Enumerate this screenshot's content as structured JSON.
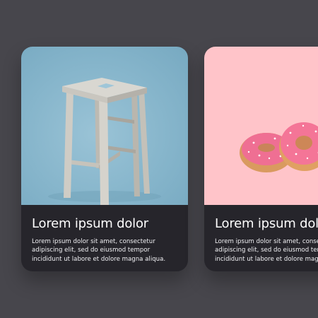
{
  "cards": [
    {
      "title": "Lorem ipsum dolor",
      "description_lines": [
        "Lorem ipsum dolor sit amet, consectetur",
        "adipiscing elit, sed do eiusmod tempor",
        "incididunt ut labore et dolore magna aliqua."
      ],
      "image": "wooden-stool",
      "image_background": "#86b5cb"
    },
    {
      "title": "Lorem ipsum dolor",
      "description_lines": [
        "Lorem ipsum dolor sit amet, consectetur",
        "adipiscing elit, sed do eiusmod tempor",
        "incididunt ut labore et dolore magna aliqua."
      ],
      "image": "pink-donuts",
      "image_background": "#ffc4c9"
    }
  ],
  "colors": {
    "page_background": "#47464c",
    "card_body": "#26252b",
    "text": "#ffffff"
  }
}
